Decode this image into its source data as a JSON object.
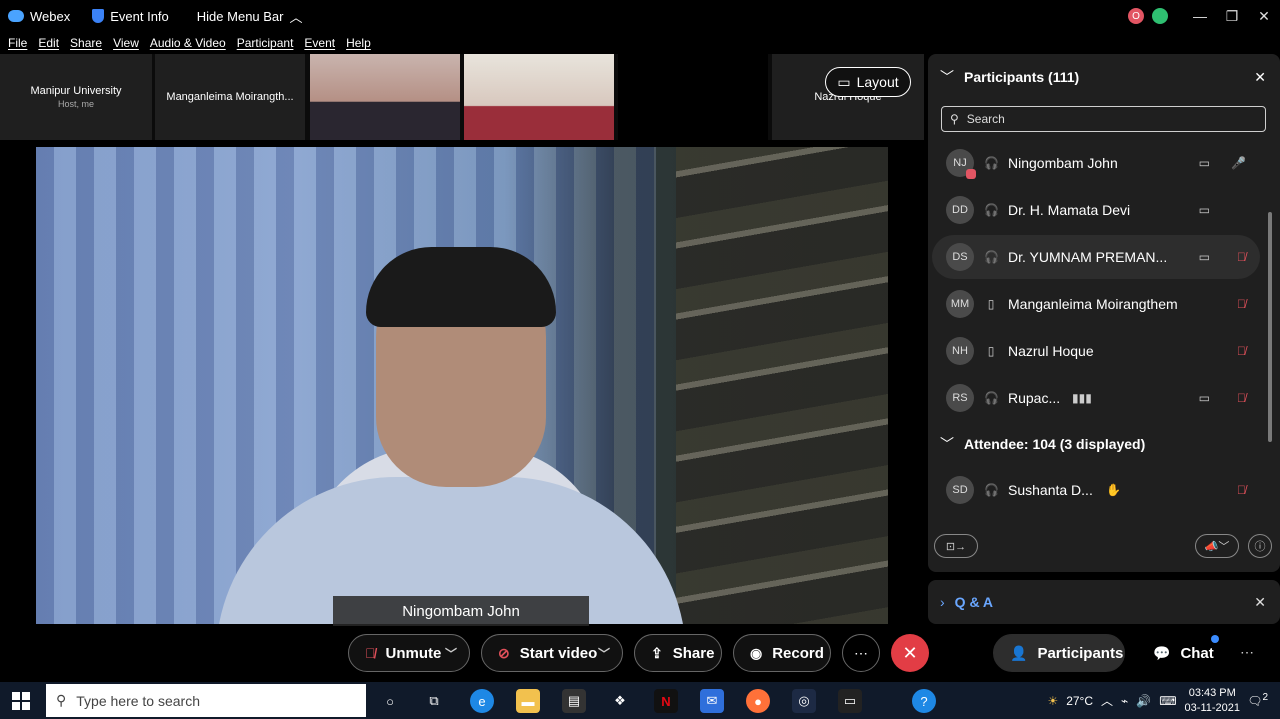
{
  "titlebar": {
    "app_name": "Webex",
    "event_info": "Event Info",
    "hide_menu": "Hide Menu Bar",
    "avatar_letter": "O"
  },
  "menu": [
    "File",
    "Edit",
    "Share",
    "View",
    "Audio & Video",
    "Participant",
    "Event",
    "Help"
  ],
  "thumbnails": [
    {
      "name": "Manipur University",
      "sub": "Host, me"
    },
    {
      "name": "Manganleima Moirangth...",
      "sub": ""
    },
    {
      "name": "",
      "sub": ""
    },
    {
      "name": "",
      "sub": ""
    },
    {
      "name": "",
      "sub": ""
    },
    {
      "name": "Nazrul Hoque",
      "sub": ""
    }
  ],
  "layout_label": "Layout",
  "active_speaker": "Ningombam John",
  "participants_panel": {
    "title": "Participants (111)",
    "search_placeholder": "Search",
    "rows": [
      {
        "initials": "NJ",
        "name": "Ningombam John",
        "device": "headset",
        "video": true,
        "mic": "live"
      },
      {
        "initials": "DD",
        "name": "Dr. H. Mamata Devi",
        "device": "headset",
        "video": true,
        "mic": ""
      },
      {
        "initials": "DS",
        "name": "Dr. YUMNAM PREMAN...",
        "device": "headset",
        "video": true,
        "mic": "muted"
      },
      {
        "initials": "MM",
        "name": "Manganleima Moirangthem",
        "device": "mobile",
        "video": false,
        "mic": "muted"
      },
      {
        "initials": "NH",
        "name": "Nazrul Hoque",
        "device": "mobile",
        "video": false,
        "mic": "muted"
      },
      {
        "initials": "RS",
        "name": "Rupac...",
        "device": "headset",
        "video": true,
        "mic": "muted"
      }
    ],
    "attendee_header": "Attendee: 104 (3 displayed)",
    "attendees": [
      {
        "initials": "SD",
        "name": "Sushanta D...",
        "mic": "muted"
      }
    ]
  },
  "qa_label": "Q & A",
  "controls": {
    "unmute": "Unmute",
    "start_video": "Start video",
    "share": "Share",
    "record": "Record",
    "participants": "Participants",
    "chat": "Chat"
  },
  "taskbar": {
    "search_placeholder": "Type here to search",
    "temperature": "27°C",
    "time": "03:43 PM",
    "date": "03-11-2021",
    "notifications": "2"
  }
}
